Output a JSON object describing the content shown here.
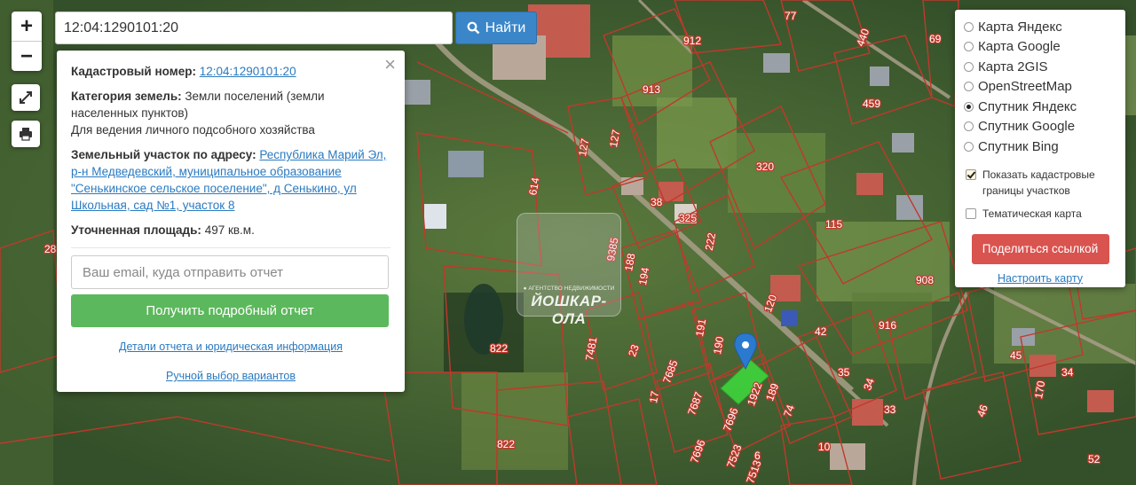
{
  "map": {
    "labels": [
      "912",
      "913",
      "127",
      "127",
      "320",
      "614",
      "38",
      "325",
      "115",
      "222",
      "188",
      "194",
      "120",
      "822",
      "822",
      "916",
      "908",
      "459",
      "69",
      "77",
      "440",
      "17",
      "23",
      "7685",
      "7687",
      "1922",
      "189",
      "74",
      "35",
      "34",
      "33",
      "42",
      "170",
      "45",
      "34",
      "46",
      "7696",
      "7696",
      "7523",
      "6",
      "7513",
      "191",
      "190",
      "7481",
      "28",
      "9385",
      "10",
      "52"
    ],
    "zoom_in": "+",
    "zoom_out": "−"
  },
  "search": {
    "value": "12:04:1290101:20",
    "button_label": "Найти"
  },
  "info": {
    "cadastral_label": "Кадастровый номер:",
    "cadastral_value": "12:04:1290101:20",
    "category_label": "Категория земель:",
    "category_value": "Земли поселений (земли населенных пунктов)",
    "use_value": "Для ведения личного подсобного хозяйства",
    "address_label": "Земельный участок по адресу:",
    "address_value": "Республика Марий Эл, р-н Медведевский, муниципальное образование \"Сенькинское сельское поселение\", д Сенькино, ул Школьная, сад №1, участок 8",
    "area_label": "Уточненная площадь:",
    "area_value": "497 кв.м.",
    "email_placeholder": "Ваш email, куда отправить отчет",
    "report_button": "Получить подробный отчет",
    "details_link": "Детали отчета и юридическая информация",
    "manual_link": "Ручной выбор вариантов"
  },
  "layers": {
    "options": [
      {
        "label": "Карта Яндекс",
        "selected": false
      },
      {
        "label": "Карта Google",
        "selected": false
      },
      {
        "label": "Карта 2GIS",
        "selected": false
      },
      {
        "label": "OpenStreetMap",
        "selected": false
      },
      {
        "label": "Спутник Яндекс",
        "selected": true
      },
      {
        "label": "Спутник Google",
        "selected": false
      },
      {
        "label": "Спутник Bing",
        "selected": false
      }
    ],
    "show_borders_label": "Показать кадастровые границы участков",
    "show_borders_checked": true,
    "thematic_label": "Тематическая карта",
    "thematic_checked": false,
    "share_button": "Поделиться ссылкой",
    "settings_link": "Настроить карту"
  },
  "watermark": {
    "small_text": "● АГЕНТСТВО НЕДВИЖИМОСТИ",
    "big_text": "ЙОШКАР-ОЛА"
  },
  "colors": {
    "search_button": "#3a86c8",
    "report_button": "#5cb85c",
    "share_button": "#d9534f",
    "boundary": "#c0392b",
    "selected_parcel": "#3ddc3d",
    "marker": "#2b7ad0"
  }
}
